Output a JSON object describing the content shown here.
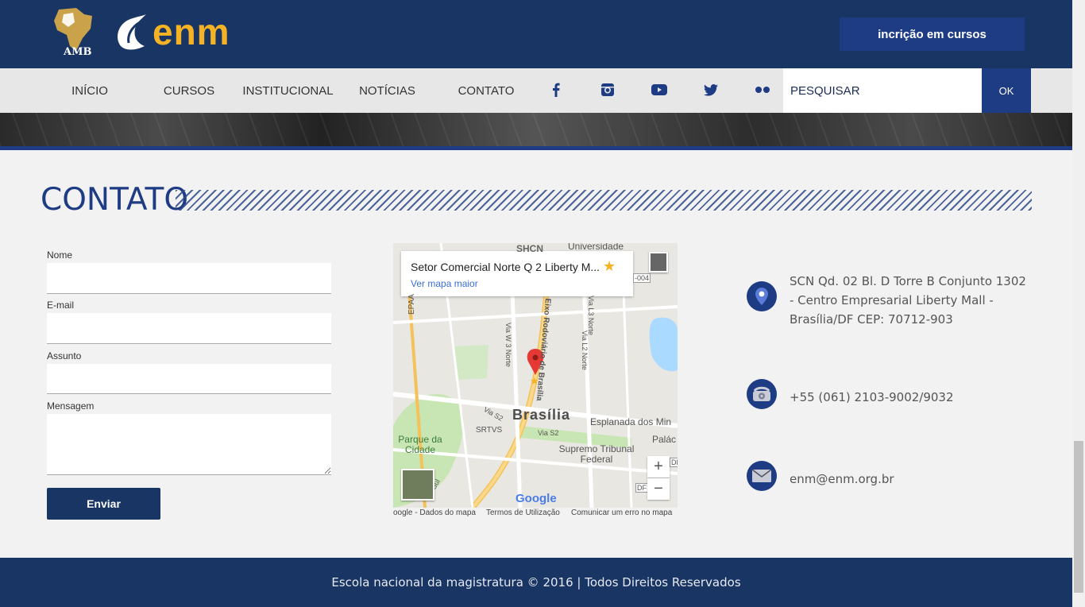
{
  "header": {
    "amb_label": "AMB",
    "enm_label": "enm",
    "signup_label": "incrição em cursos"
  },
  "nav": {
    "items": [
      "INÍCIO",
      "CURSOS",
      "INSTITUCIONAL",
      "NOTÍCIAS",
      "CONTATO"
    ],
    "social": [
      "facebook-icon",
      "instagram-icon",
      "youtube-icon",
      "twitter-icon",
      "flickr-icon"
    ],
    "search_placeholder": "PESQUISAR",
    "search_button": "OK"
  },
  "contact": {
    "title": "CONTATO",
    "form": {
      "name_label": "Nome",
      "email_label": "E-mail",
      "subject_label": "Assunto",
      "message_label": "Mensagem",
      "submit_label": "Enviar"
    },
    "map": {
      "card_title": "Setor Comercial Norte Q 2 Liberty M...",
      "card_link": "Ver mapa maior",
      "labels": {
        "shcn": "SHCN",
        "universidade": "Universidade",
        "road_004": "-004",
        "epaa": "EPAA",
        "via_w3": "Via W 3 Norte",
        "eixo": "Eixo Rodoviário de Brasília",
        "via_l3": "Via L3 Norte",
        "via_l2": "Via L2 Norte",
        "brasilia": "Brasília",
        "esplanada": "Esplanada dos Min",
        "palacio": "Palác",
        "via_s2": "Via S2",
        "via_s2b": "Via S2",
        "srtvs": "SRTVS",
        "parque": "Parque da Cidade",
        "supremo": "Supremo Tribunal Federal",
        "df": "DF",
        "df2": "DF",
        "via_sul": "Via Sul"
      },
      "zoom_in": "+",
      "zoom_out": "−",
      "google": "Google",
      "footer_data": "oogle - Dados do mapa",
      "footer_terms": "Termos de Utilização",
      "footer_report": "Comunicar um erro no mapa"
    },
    "info": {
      "address": "SCN Qd. 02 Bl. D Torre B Conjunto 1302 - Centro Empresarial Liberty Mall - Brasília/DF CEP: 70712-903",
      "phone": "+55 (061) 2103-9002/9032",
      "email": "enm@enm.org.br"
    }
  },
  "footer": {
    "text": "Escola nacional da magistratura © 2016 | Todos Direitos Reservados"
  },
  "colors": {
    "navy": "#183564",
    "accent_blue": "#1e3c84",
    "logo_gold": "#f4b224"
  }
}
